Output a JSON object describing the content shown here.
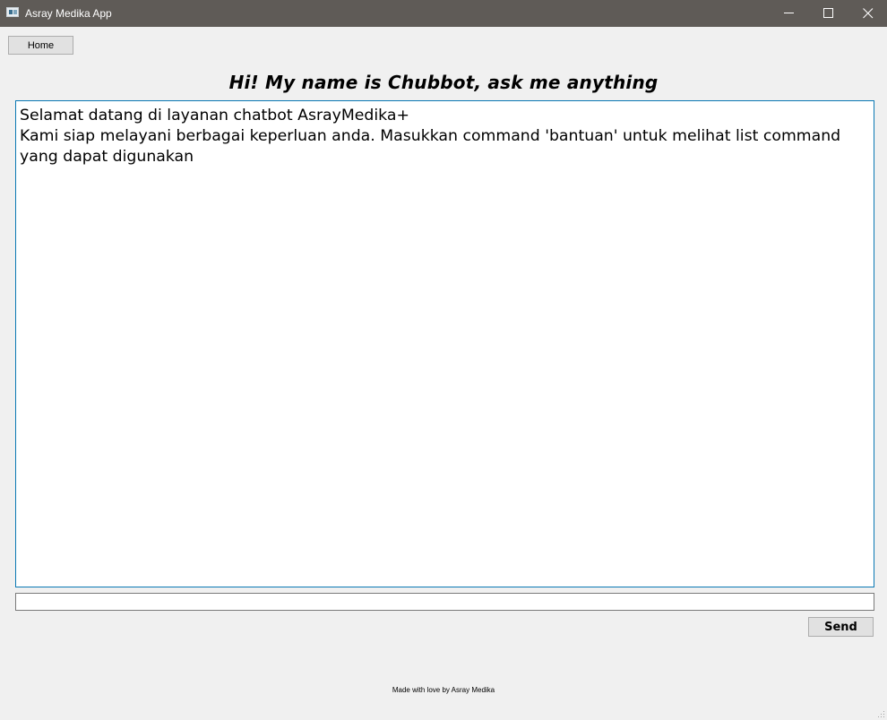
{
  "window": {
    "title": "Asray Medika App",
    "minimize_icon": "minimize-icon",
    "maximize_icon": "maximize-icon",
    "close_icon": "close-icon"
  },
  "nav": {
    "home_label": "Home"
  },
  "heading": "Hi! My name is Chubbot, ask me anything",
  "chat": {
    "messages": [
      "Selamat datang di layanan chatbot AsrayMedika+",
      "Kami siap melayani berbagai keperluan anda. Masukkan command 'bantuan' untuk melihat list command yang dapat digunakan"
    ]
  },
  "input": {
    "value": "",
    "placeholder": ""
  },
  "send_label": "Send",
  "footer": "Made with love by Asray Medika",
  "colors": {
    "titlebar": "#5f5b57",
    "background": "#f0f0f0",
    "focus_border": "#0a78b4"
  }
}
